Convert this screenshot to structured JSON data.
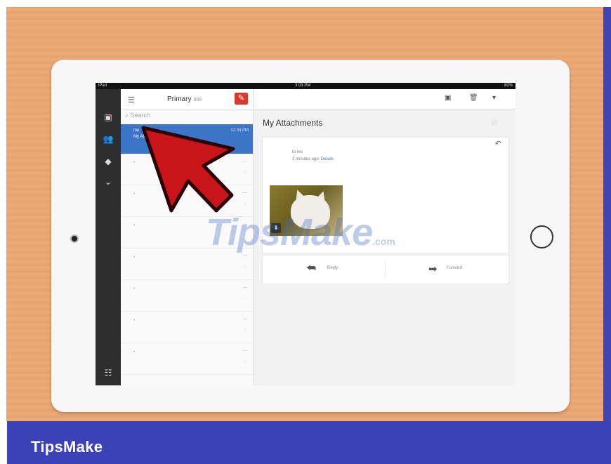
{
  "brand": "TipsMake",
  "watermark": {
    "main": "TipsMake",
    "suffix": ".com"
  },
  "status_bar": {
    "left": "iPad",
    "time": "3:03 PM",
    "right": "80%"
  },
  "list": {
    "title": "Primary",
    "count": "999",
    "search_placeholder": "Search",
    "selected": {
      "sender": "me",
      "subject": "My Attachments",
      "time": "12:34 PM"
    }
  },
  "detail": {
    "subject": "My Attachments",
    "to": "to me",
    "when": "2 minutes ago",
    "details_link": "Details",
    "reply_label": "Reply",
    "forward_label": "Forward"
  }
}
